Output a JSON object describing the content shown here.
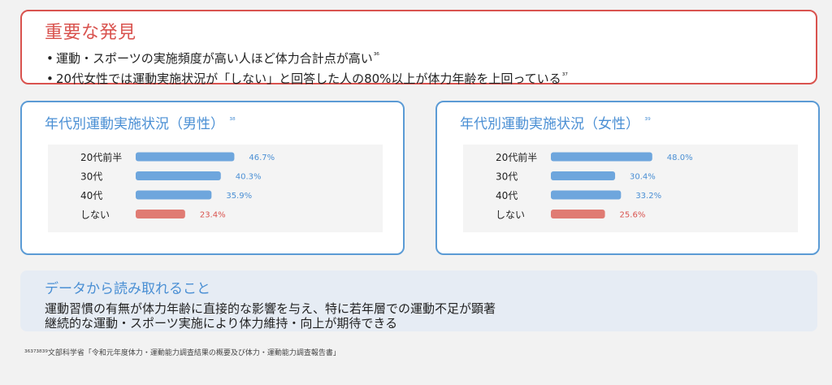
{
  "key_findings": {
    "title": "重要な発見",
    "items": [
      {
        "text": "運動・スポーツの実施頻度が高い人ほど体力合計点が高い",
        "ref": "³⁶"
      },
      {
        "text": "20代女性では運動実施状況が「しない」と回答した人の80%以上が体力年齢を上回っている",
        "ref": "³⁷"
      }
    ]
  },
  "chart_data": [
    {
      "type": "bar",
      "orientation": "horizontal",
      "title": "年代別運動実施状況（男性）",
      "title_ref": "³⁸",
      "categories": [
        "20代前半",
        "30代",
        "40代",
        "しない"
      ],
      "values": [
        46.7,
        40.3,
        35.9,
        23.4
      ],
      "value_labels": [
        "46.7%",
        "40.3%",
        "35.9%",
        "23.4%"
      ],
      "colors": [
        "#6ea6dd",
        "#6ea6dd",
        "#6ea6dd",
        "#e07b73"
      ],
      "label_colors": [
        "#4a8fd4",
        "#4a8fd4",
        "#4a8fd4",
        "#d9534f"
      ],
      "xlim": [
        0,
        100
      ],
      "grid": false,
      "legend": "none"
    },
    {
      "type": "bar",
      "orientation": "horizontal",
      "title": "年代別運動実施状況（女性）",
      "title_ref": "³⁹",
      "categories": [
        "20代前半",
        "30代",
        "40代",
        "しない"
      ],
      "values": [
        48.0,
        30.4,
        33.2,
        25.6
      ],
      "value_labels": [
        "48.0%",
        "30.4%",
        "33.2%",
        "25.6%"
      ],
      "colors": [
        "#6ea6dd",
        "#6ea6dd",
        "#6ea6dd",
        "#e07b73"
      ],
      "label_colors": [
        "#4a8fd4",
        "#4a8fd4",
        "#4a8fd4",
        "#d9534f"
      ],
      "xlim": [
        0,
        100
      ],
      "grid": false,
      "legend": "none"
    }
  ],
  "summary": {
    "title": "データから読み取れること",
    "lines": [
      "運動習慣の有無が体力年齢に直接的な影響を与え、特に若年層での運動不足が顕著",
      "継続的な運動・スポーツ実施により体力維持・向上が期待できる"
    ]
  },
  "footnote": "³⁶³⁷³⁸³⁹文部科学省「令和元年度体力・運動能力調査結果の概要及び体力・運動能力調査報告書」",
  "colors": {
    "accent_red": "#d9534f",
    "accent_blue": "#4a8fd4",
    "bar_blue": "#6ea6dd",
    "bar_red": "#e07b73"
  }
}
